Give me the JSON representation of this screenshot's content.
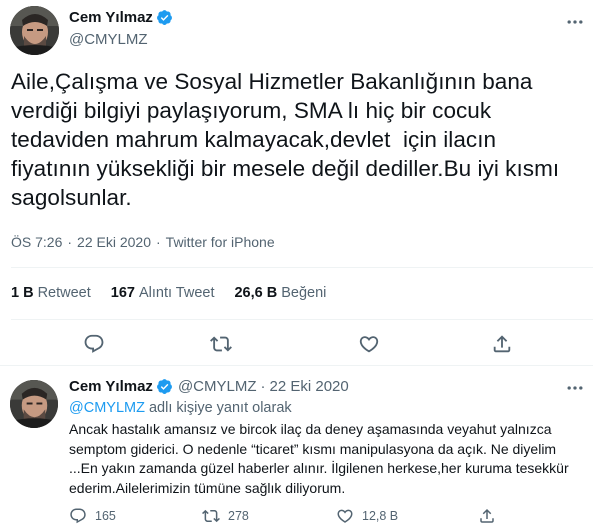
{
  "main_tweet": {
    "author_name": "Cem Yılmaz",
    "author_handle": "@CMYLMZ",
    "text": "Aile,Çalışma ve Sosyal Hizmetler Bakanlığının bana\nverdiği bilgiyi paylaşıyorum, SMA lı hiç bir cocuk\ntedaviden mahrum kalmayacak,devlet  için ilacın\nfiyatının yüksekliği bir mesele değil dediller.Bu iyi kısmı\nsagolsunlar.",
    "time": "ÖS 7:26",
    "date": "22 Eki 2020",
    "dot": "·",
    "source": "Twitter for iPhone",
    "stats": [
      {
        "value": "1 B",
        "label": "Retweet"
      },
      {
        "value": "167",
        "label": "Alıntı Tweet"
      },
      {
        "value": "26,6 B",
        "label": "Beğeni"
      }
    ]
  },
  "reply_tweet": {
    "author_name": "Cem Yılmaz",
    "author_handle": "@CMYLMZ",
    "dot": "·",
    "date": "22 Eki 2020",
    "reply_mention": "@CMYLMZ",
    "reply_suffix": " adlı kişiye yanıt olarak",
    "text": "Ancak hastalık amansız ve bircok ilaç da deney aşamasında veyahut yalnızca semptom giderici. O nedenle “ticaret” kısmı manipulasyona da açık. Ne diyelim ...En yakın zamanda güzel haberler alınır. İlgilenen herkese,her kuruma tesekkür ederim.Ailelerimizin tümüne sağlık diliyorum.",
    "counts": {
      "replies": "165",
      "retweets": "278",
      "likes": "12,8 B"
    }
  },
  "icons": {
    "verified": "verified-badge-icon",
    "more": "more-options-icon",
    "reply": "reply-icon",
    "retweet": "retweet-icon",
    "like": "heart-icon",
    "share": "share-icon"
  },
  "colors": {
    "verified": "#1d9bf0",
    "mention": "#1d9bf0",
    "secondary_text": "#536471",
    "primary_text": "#0f1419",
    "divider": "#eff3f4"
  }
}
